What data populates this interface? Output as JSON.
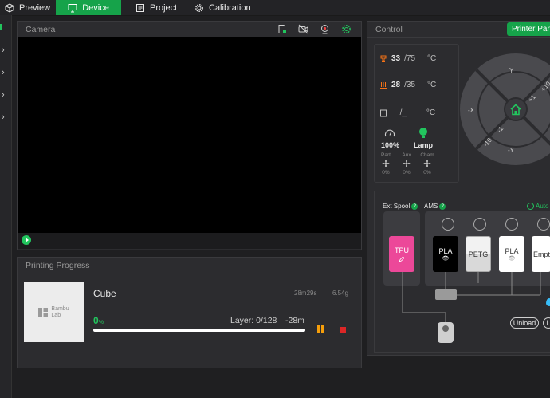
{
  "tabs": [
    {
      "label": "Preview",
      "active": false,
      "icon": "cube-icon"
    },
    {
      "label": "Device",
      "active": true,
      "icon": "device-monitor-icon"
    },
    {
      "label": "Project",
      "active": false,
      "icon": "project-icon"
    },
    {
      "label": "Calibration",
      "active": false,
      "icon": "gear-icon"
    }
  ],
  "camera": {
    "title": "Camera",
    "icons": [
      "sd-card-icon",
      "camera-off-icon",
      "webcam-icon",
      "settings-icon"
    ]
  },
  "printing": {
    "title": "Printing Progress",
    "logo_text_1": "Bambu",
    "logo_text_2": "Lab",
    "job_name": "Cube",
    "time_estimate": "28m29s",
    "weight": "6.54g",
    "percent": "0",
    "percent_unit": "%",
    "progress_fraction": 0,
    "layer": "Layer: 0/128",
    "remaining": "-28m"
  },
  "control": {
    "title": "Control",
    "printer_parts_label": "Printer Parts",
    "nozzle": {
      "current": "33",
      "target": "/75",
      "unit": "°C"
    },
    "bed": {
      "current": "28",
      "target": "/35",
      "unit": "°C"
    },
    "chamber": {
      "current": "_",
      "target": "/_",
      "unit": "°C"
    },
    "speed": "100%",
    "lamp": "Lamp",
    "fans": [
      {
        "label": "Part",
        "value": "0%"
      },
      {
        "label": "Aux",
        "value": "0%"
      },
      {
        "label": "Cham",
        "value": "0%"
      }
    ],
    "jog": {
      "y_up": "Y",
      "y_down": "-Y",
      "x_left": "-X",
      "plus10": "+10",
      "plus1": "+1",
      "minus1": "-1",
      "minus10": "-10"
    }
  },
  "ams": {
    "ext_spool_label": "Ext Spool",
    "ams_label": "AMS",
    "auto_label": "Auto",
    "ext_spool": {
      "label": "TPU",
      "color": "#ec4899"
    },
    "slots": [
      {
        "label": "PLA",
        "color": "#000000",
        "text_color": "#ffffff"
      },
      {
        "label": "PETG",
        "color": "#d9d9d9",
        "text_color": "#333333"
      },
      {
        "label": "PLA",
        "color": "#ffffff",
        "text_color": "#333333"
      },
      {
        "label": "Empty",
        "color": "#ffffff",
        "text_color": "#333333"
      }
    ],
    "unload_label": "Unload",
    "load_label": "L"
  },
  "colors": {
    "accent": "#16a34a",
    "accent_light": "#22c55e",
    "bg": "#1f1f21",
    "panel": "#2c2c2f"
  }
}
